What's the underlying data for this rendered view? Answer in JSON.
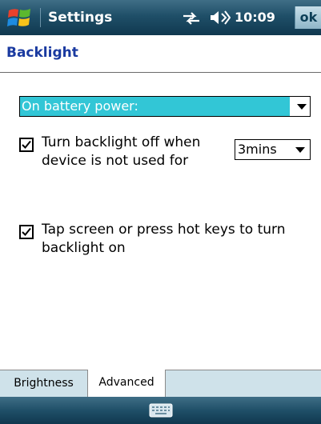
{
  "titlebar": {
    "title": "Settings",
    "time": "10:09",
    "ok_label": "ok",
    "icons": [
      "windows-start-icon",
      "connectivity-icon",
      "volume-icon"
    ]
  },
  "page": {
    "heading": "Backlight"
  },
  "power_source": {
    "selected": "On battery power:"
  },
  "options": {
    "turn_off": {
      "checked": true,
      "label_line1": "Turn backlight off when",
      "label_line2": "device is not used for",
      "timeout_value": "3mins"
    },
    "tap_on": {
      "checked": true,
      "label_line1": "Tap screen or press hot keys to turn",
      "label_line2": "backlight on"
    }
  },
  "tabs": [
    {
      "label": "Brightness",
      "active": false
    },
    {
      "label": "Advanced",
      "active": true
    }
  ],
  "softbar": {
    "icon": "keyboard-icon"
  },
  "colors": {
    "title_bar": "#1f4f68",
    "heading_text": "#1a3aa0",
    "selection_highlight": "#32c6d6",
    "tab_strip": "#cfe2ea"
  }
}
